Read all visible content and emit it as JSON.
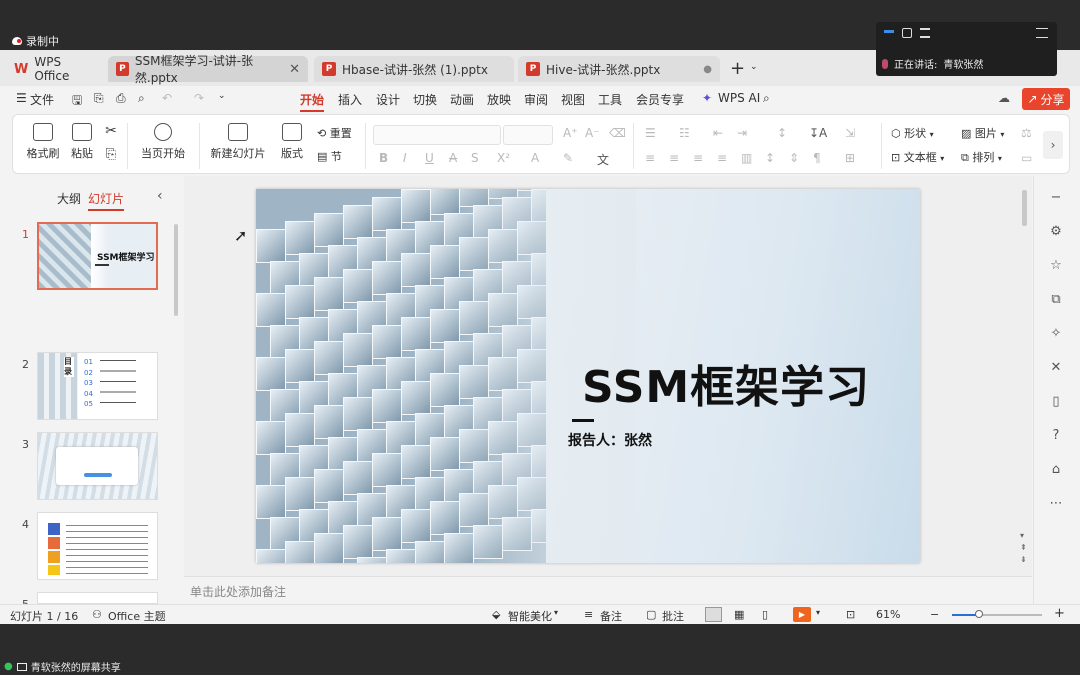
{
  "recording": {
    "label": "录制中"
  },
  "meeting": {
    "speaking_label": "正在讲话:",
    "speaker": "青软张然"
  },
  "tabs": [
    {
      "label": "WPS Office"
    },
    {
      "label": "SSM框架学习-试讲-张然.pptx"
    },
    {
      "label": "Hbase-试讲-张然 (1).pptx"
    },
    {
      "label": "Hive-试讲-张然.pptx"
    }
  ],
  "menu": {
    "file": "文件",
    "items": [
      "开始",
      "插入",
      "设计",
      "切换",
      "动画",
      "放映",
      "审阅",
      "视图",
      "工具",
      "会员专享"
    ],
    "wps_ai": "WPS AI",
    "share": "分享"
  },
  "ribbon": {
    "format_painter": "格式刷",
    "paste": "粘贴",
    "play_from_current": "当页开始",
    "new_slide": "新建幻灯片",
    "layout": "版式",
    "reset": "重置",
    "section": "节",
    "shape": "形状",
    "picture": "图片",
    "textbox": "文本框",
    "arrange": "排列"
  },
  "panel": {
    "tab_outline": "大纲",
    "tab_slides": "幻灯片",
    "slide_numbers": [
      "1",
      "2",
      "3",
      "4",
      "5"
    ],
    "thumb1_title": "SSM框架学习",
    "thumb2_heading": "目录",
    "thumb2_items": [
      "01",
      "02",
      "03",
      "04",
      "05"
    ]
  },
  "slide": {
    "title": "SSM框架学习",
    "reporter": "报告人：张然"
  },
  "notes": {
    "placeholder": "单击此处添加备注"
  },
  "status": {
    "slide_counter": "幻灯片 1 / 16",
    "theme": "Office 主题",
    "beautify": "智能美化",
    "notes": "备注",
    "comments": "批注",
    "zoom": "61%",
    "zoom_fraction": 0.61
  },
  "screen_share": {
    "label": "青软张然的屏幕共享"
  },
  "colors": {
    "accent": "#d33a2c",
    "share": "#e8452c",
    "play": "#f0641e"
  }
}
